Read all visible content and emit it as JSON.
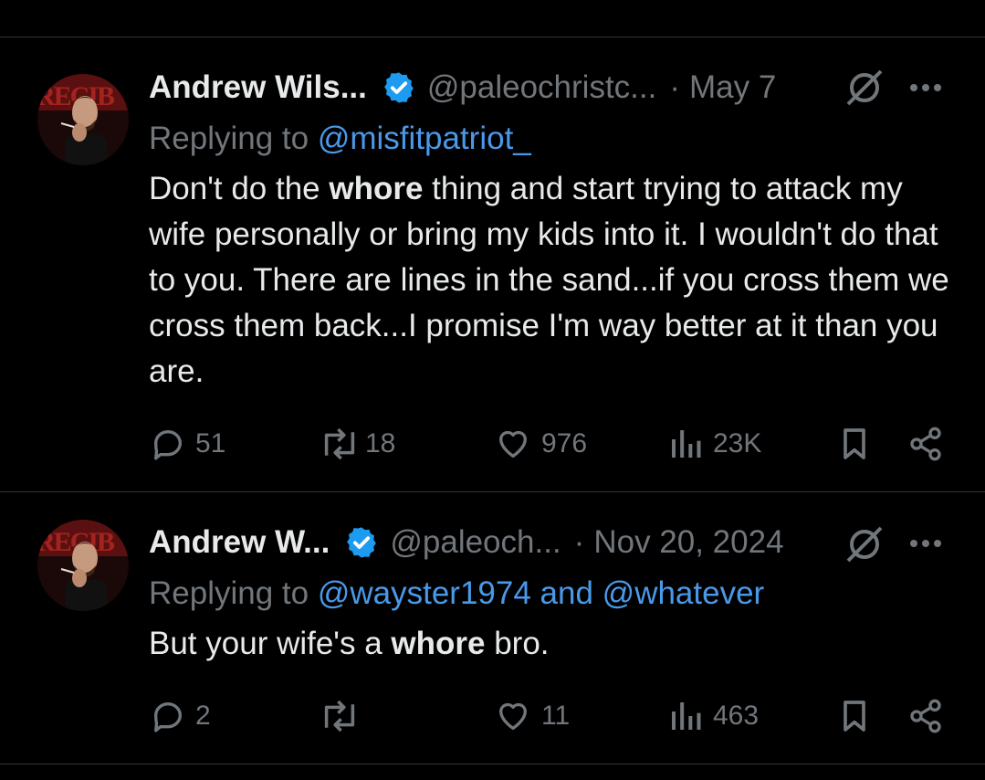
{
  "tweets": [
    {
      "author_name": "Andrew Wils...",
      "handle": "@paleochristc...",
      "separator": "·",
      "date": "May 7",
      "replying_prefix": "Replying to",
      "replying_to": "@misfitpatriot_",
      "body_parts": [
        {
          "text": "Don't do the ",
          "bold": false
        },
        {
          "text": "whore",
          "bold": true
        },
        {
          "text": " thing and start trying to attack my wife personally or bring my kids into it. I wouldn't do that to you. There are lines in the sand...if you cross them we cross them back...I promise I'm way better at it than you are.",
          "bold": false
        }
      ],
      "stats": {
        "replies": "51",
        "reposts": "18",
        "likes": "976",
        "views": "23K"
      }
    },
    {
      "author_name": "Andrew W...",
      "handle": "@paleoch...",
      "separator": "·",
      "date": "Nov 20, 2024",
      "replying_prefix": "Replying to",
      "replying_to": "@wayster1974 and @whatever",
      "body_parts": [
        {
          "text": "But your wife's a ",
          "bold": false
        },
        {
          "text": "whore",
          "bold": true
        },
        {
          "text": " bro.",
          "bold": false
        }
      ],
      "stats": {
        "replies": "2",
        "reposts": "",
        "likes": "11",
        "views": "463"
      }
    }
  ],
  "colors": {
    "background": "#000000",
    "text": "#e7e9ea",
    "muted": "#71767b",
    "accent": "#1d9bf0",
    "mention": "#4a99e9",
    "divider": "#2f3336"
  },
  "icons": [
    "reply-icon",
    "repost-icon",
    "like-icon",
    "views-icon",
    "bookmark-icon",
    "share-icon",
    "grok-icon",
    "more-icon",
    "verified-badge-icon"
  ]
}
